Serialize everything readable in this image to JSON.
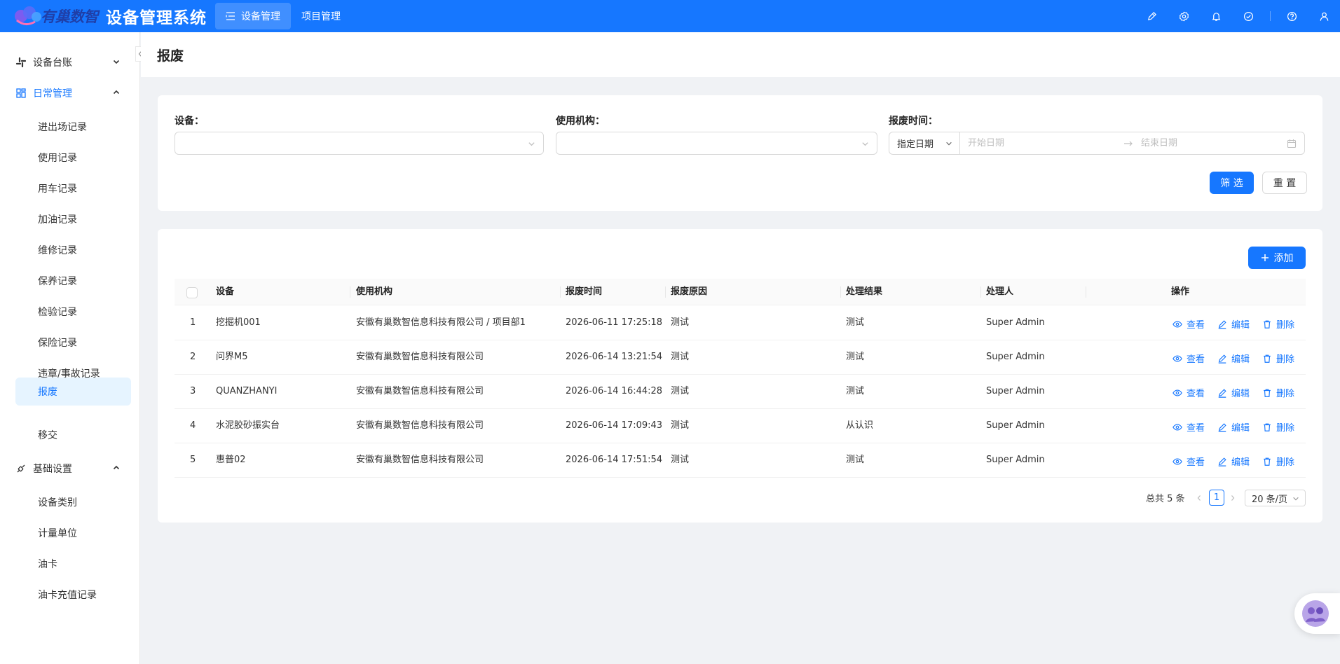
{
  "header": {
    "logo_text": "有巢数智",
    "app_title": "设备管理系统",
    "nav": [
      {
        "label": "设备管理",
        "active": true
      },
      {
        "label": "项目管理",
        "active": false
      }
    ],
    "brand_color": "#1677ff"
  },
  "sidebar": {
    "groups": [
      {
        "label": "设备台账",
        "icon": "slack-icon",
        "open": false
      },
      {
        "label": "日常管理",
        "icon": "dashboard-icon",
        "open": true,
        "items": [
          "进出场记录",
          "使用记录",
          "用车记录",
          "加油记录",
          "维修记录",
          "保养记录",
          "检验记录",
          "保险记录",
          "违章/事故记录",
          "报废",
          "移交"
        ]
      },
      {
        "label": "基础设置",
        "icon": "api-icon",
        "open": true,
        "items": [
          "设备类别",
          "计量单位",
          "油卡",
          "油卡充值记录"
        ]
      }
    ],
    "active_item": "报废"
  },
  "page": {
    "title": "报废"
  },
  "filters": {
    "device_label": "设备：",
    "org_label": "使用机构：",
    "time_label": "报废时间：",
    "time_mode": "指定日期",
    "start_placeholder": "开始日期",
    "end_placeholder": "结束日期",
    "filter_button": "筛 选",
    "reset_button": "重 置"
  },
  "table": {
    "add_button": "添加",
    "columns": [
      "设备",
      "使用机构",
      "报废时间",
      "报废原因",
      "处理结果",
      "处理人",
      "操作"
    ],
    "actions": [
      "查看",
      "编辑",
      "删除"
    ],
    "rows": [
      {
        "no": "1",
        "device": "挖掘机001",
        "org": "安徽有巢数智信息科技有限公司 / 项目部1",
        "time": "2026-06-11 17:25:18",
        "reason": "测试",
        "result": "测试",
        "handler": "Super Admin"
      },
      {
        "no": "2",
        "device": "问界M5",
        "org": "安徽有巢数智信息科技有限公司",
        "time": "2026-06-14 13:21:54",
        "reason": "测试",
        "result": "测试",
        "handler": "Super Admin"
      },
      {
        "no": "3",
        "device": "QUANZHANYI",
        "org": "安徽有巢数智信息科技有限公司",
        "time": "2026-06-14 16:44:28",
        "reason": "测试",
        "result": "测试",
        "handler": "Super Admin"
      },
      {
        "no": "4",
        "device": "水泥胶砂振实台",
        "org": "安徽有巢数智信息科技有限公司",
        "time": "2026-06-14 17:09:43",
        "reason": "测试",
        "result": "从认识",
        "handler": "Super Admin"
      },
      {
        "no": "5",
        "device": "惠普02",
        "org": "安徽有巢数智信息科技有限公司",
        "time": "2026-06-14 17:51:54",
        "reason": "测试",
        "result": "测试",
        "handler": "Super Admin"
      }
    ]
  },
  "pagination": {
    "total_text": "总共 5 条",
    "current_page": "1",
    "page_size": "20 条/页"
  }
}
